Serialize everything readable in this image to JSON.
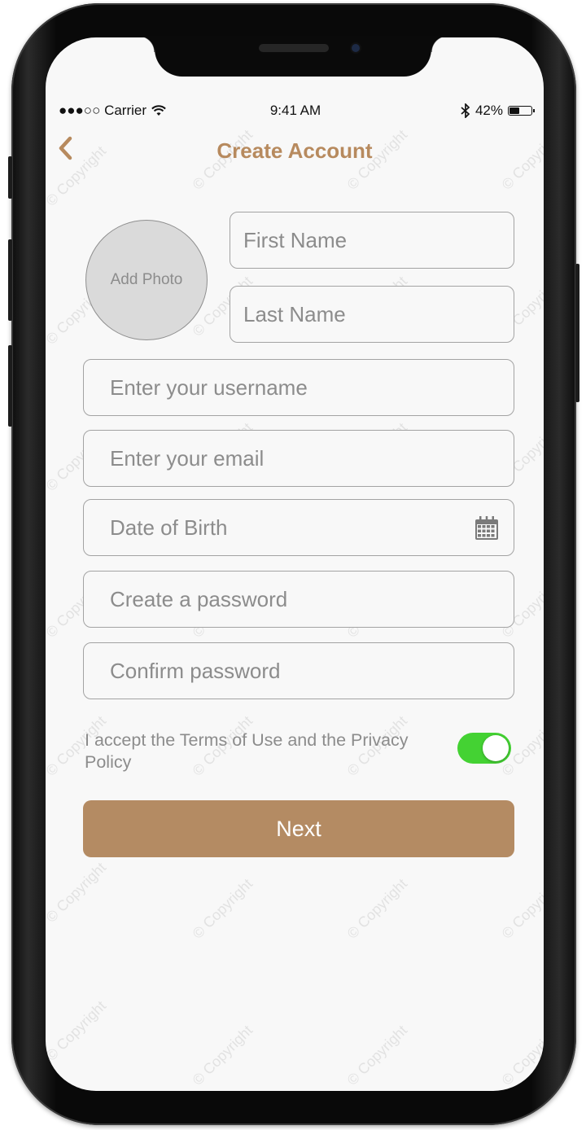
{
  "status_bar": {
    "signal_carrier": "●●●○○ Carrier",
    "time": "9:41 AM",
    "battery": "42%",
    "battery_level": 0.42
  },
  "nav": {
    "back_icon": "chevron-left-icon",
    "title": "Create Account"
  },
  "form": {
    "add_photo": "Add Photo",
    "first_name": "First Name",
    "last_name": "Last Name",
    "username": "Enter your username",
    "email": "Enter your email",
    "dob": "Date of Birth",
    "password": "Create a password",
    "confirm_password": "Confirm password",
    "terms": "I accept the Terms of Use and the Privacy Policy",
    "terms_accepted": true,
    "next": "Next"
  },
  "watermark": "© Copyright",
  "colors": {
    "accent": "#b78a5e",
    "button": "#b48b63",
    "toggle_on": "#44d233",
    "background": "#f8f8f8"
  }
}
